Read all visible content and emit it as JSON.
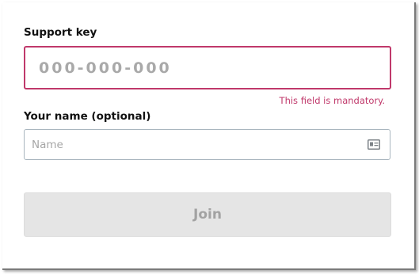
{
  "form": {
    "support_key": {
      "label": "Support key",
      "placeholder": "000-000-000",
      "value": "",
      "error": "This field is mandatory.",
      "error_color": "#c0396b"
    },
    "name": {
      "label": "Your name (optional)",
      "placeholder": "Name",
      "value": "",
      "icon": "id-card-icon"
    },
    "join_button": {
      "label": "Join",
      "state": "disabled"
    }
  }
}
